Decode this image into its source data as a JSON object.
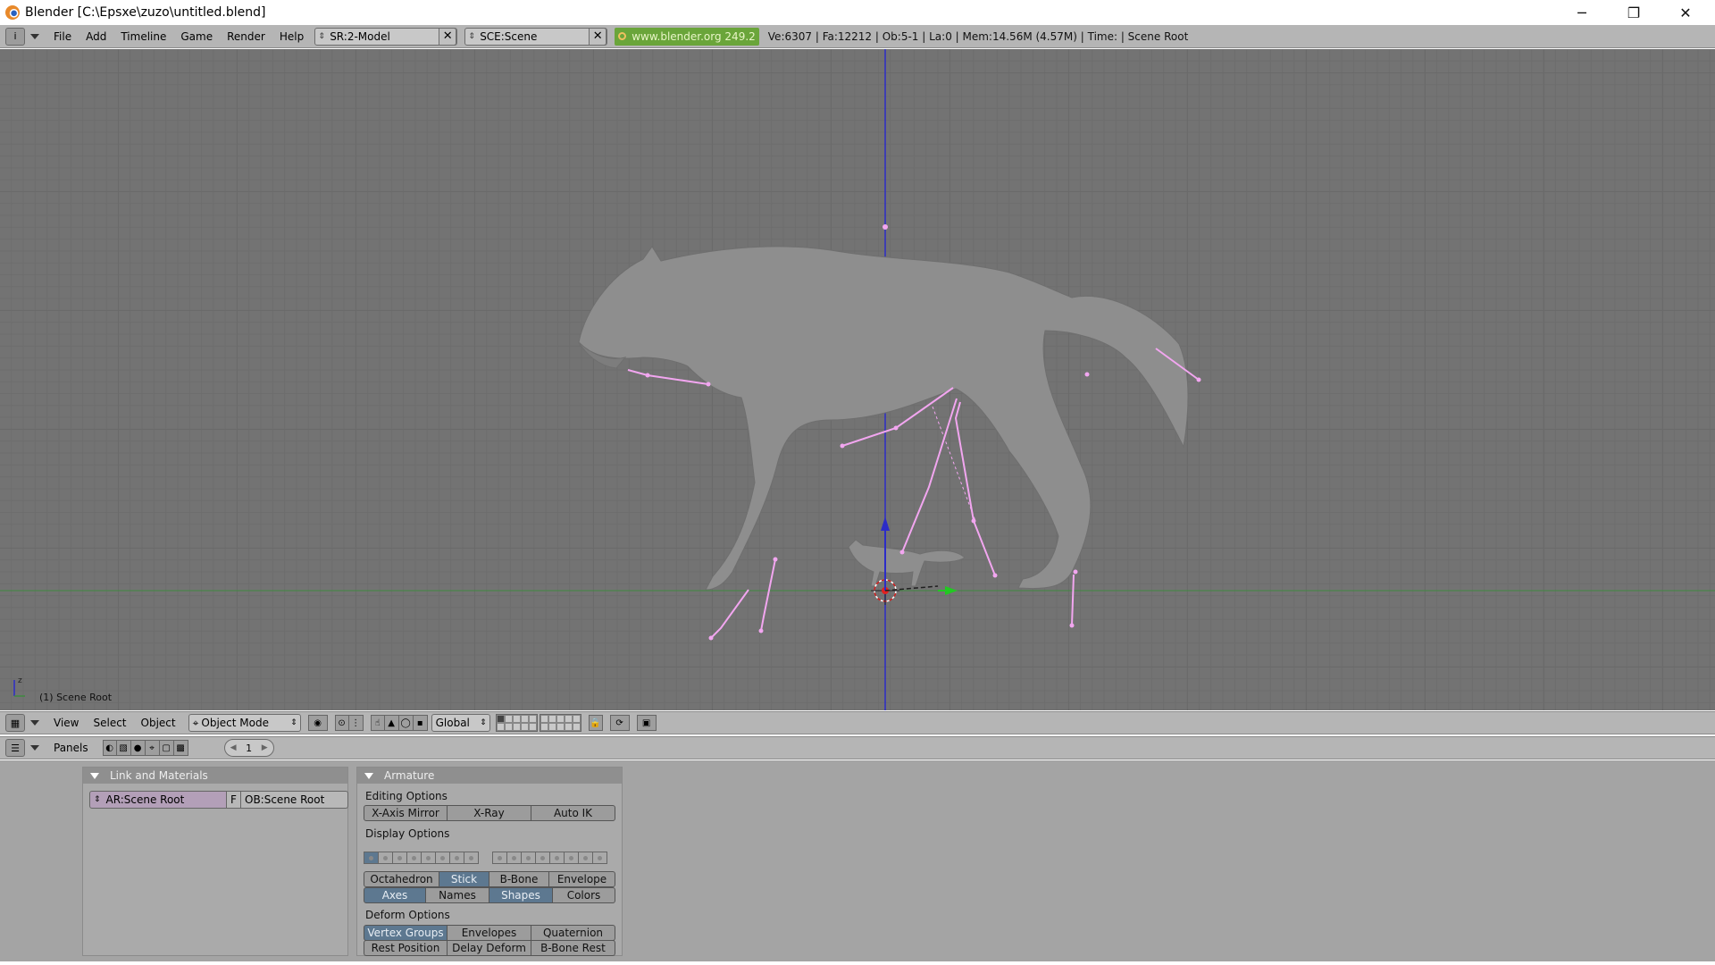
{
  "window": {
    "title": "Blender [C:\\Epsxe\\zuzo\\untitled.blend]",
    "controls": {
      "minimize": "─",
      "maximize": "❐",
      "close": "✕"
    }
  },
  "info_header": {
    "menus": [
      "File",
      "Add",
      "Timeline",
      "Game",
      "Render",
      "Help"
    ],
    "screen_field": "SR:2-Model",
    "scene_field": "SCE:Scene",
    "link": "www.blender.org 249.2",
    "stats": "Ve:6307 | Fa:12212 | Ob:5-1 | La:0  | Mem:14.56M (4.57M)  | Time: | Scene Root"
  },
  "viewport": {
    "object_label": "(1) Scene Root",
    "axis_label": "z",
    "colors": {
      "grid_bg": "#737373",
      "bones": "#f2a6f0",
      "x_axis": "#4a8a4a",
      "z_axis": "#3030c0"
    }
  },
  "view3d_header": {
    "menus": [
      "View",
      "Select",
      "Object"
    ],
    "mode": "Object Mode",
    "orientation": "Global"
  },
  "buttons_header": {
    "panels_label": "Panels",
    "frame": "1"
  },
  "panel_link": {
    "title": "Link and Materials",
    "ar_field": "AR:Scene Root",
    "f_button": "F",
    "ob_field": "OB:Scene Root"
  },
  "panel_armature": {
    "title": "Armature",
    "editing_label": "Editing Options",
    "editing_buttons": [
      "X-Axis Mirror",
      "X-Ray",
      "Auto IK"
    ],
    "display_label": "Display Options",
    "display_row1": [
      "Octahedron",
      "Stick",
      "B-Bone",
      "Envelope"
    ],
    "display_row2": [
      "Axes",
      "Names",
      "Shapes",
      "Colors"
    ],
    "deform_label": "Deform Options",
    "deform_row1": [
      "Vertex Groups",
      "Envelopes",
      "Quaternion"
    ],
    "deform_row2": [
      "Rest Position",
      "Delay Deform",
      "B-Bone Rest"
    ]
  }
}
